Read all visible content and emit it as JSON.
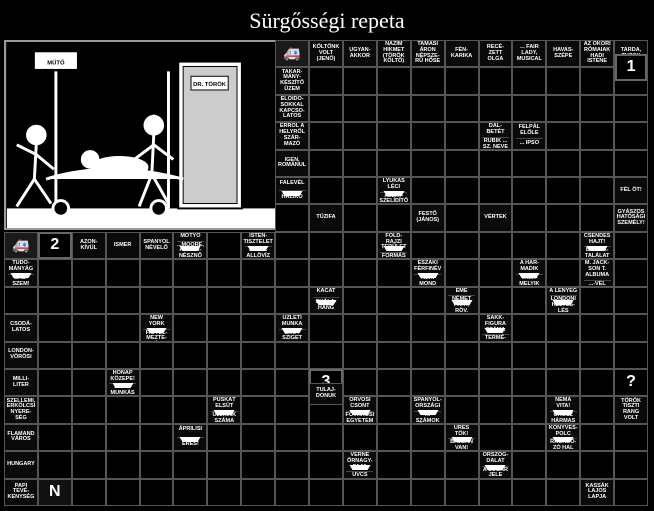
{
  "title": "Sürgősségi repeta",
  "image": {
    "sign_muto": "MŰTŐ",
    "sign_doctor": "DR. TÖRÖK"
  },
  "numbers": {
    "n1": "1",
    "n2": "2",
    "n3": "3",
    "qm": "?",
    "start_letter": "N"
  },
  "clues": {
    "koltonk": "KÖLTŐNK VOLT (JENŐ)",
    "ugyanakkor": "UGYAN-AKKOR",
    "nazim": "NÁZIM HIKMET (TÖRÖK KÖLTŐ)",
    "tamasi": "TAMÁSI ÁRON NÉPSZE-RŰ HŐSE",
    "fenkarika": "FÉN-KARIKA",
    "rece": "RECÉ-ZETT OLGA",
    "fair": "... FAIR LADY, MUSICAL",
    "havasszepe": "HAVAS-SZÉPE",
    "okori": "AZ ÓKORI RÓMAIAK HADI ISTENE",
    "tarda": "TARDA, TUZOK",
    "takarmany": "TAKAR-MÁNY-KÉSZÍTŐ ÜZEM",
    "eloidos": "ELŐIDŐ-SOKKAL KAPCSO-LATOS",
    "errol": "ERRŐL A HELYRŐL SZÁR-MAZÓ",
    "igen": "IGEN, ROMÁNUL",
    "dal": "DAL-BETÉT",
    "rubik": "RUBIK ... SZ. NEVE",
    "felpal": "FELPÁL ELŐLE",
    "ipso": "... IPSO",
    "falevel": "FALEVÉL",
    "haziko": "HÁZIKÓ",
    "lyukasleci": "LYUKAS LÉCI",
    "allat": "ÁLLAT-SZELÍDÍTŐ",
    "tuzifa": "TŰZIFA",
    "festo": "FESTŐ (JÁNOS)",
    "felot": "FÉL ÖT!",
    "gyaszos": "GYÁSZOS HATÓSÁGI SZEMÉLY!",
    "azonkivul": "AZON-KÍVÜL",
    "ismer": "ISMER",
    "spanyol": "SPANYOL NÉVELŐ",
    "motyo": "MOTYÓ",
    "moore": "...MOORE, AM. SZÍ-NÉSZNŐ",
    "isten": "ISTEN-TISZTELET",
    "fnap": "F. NAP. ALLÖVÍZ",
    "fold": "FÖLD-RAJZI TERÜLET",
    "formas": "FORMÁS",
    "vertek": "VÉRTEK",
    "csendes": "CSENDES HAJT!",
    "bomba": "BOMBA-TALÁLAT",
    "tudomany": "TUDO-MÁNYÁG",
    "babszem": "BAB-SZEM!",
    "eszaki": "ÉSZAKI FÉRFINÉV",
    "nerimond": "NÉRI MOND",
    "harmadik": "A HAR-MADIK",
    "valamelyik": "VALA-MELYIK",
    "mjackson": "M. JACK-SON T. ALBUMA",
    "vel": "...-VEL",
    "kacat": "KACAT",
    "skala": "SKÁLA-HANG",
    "eme": "EME",
    "nemet": "NÉMET PÁRT, RÖV.",
    "lenyeg": "A LÉNYEG",
    "london": "LONDONI HELYES-LÉS",
    "csodalatos": "CSODÁ-LATOS",
    "newyork": "NEW YORK",
    "figyel": "FIGYEL-MEZTE-TÉS",
    "uzleti": "ÜZLETI MUNKA",
    "skot": "SKÓT SZIGET",
    "sakk": "SAKK-FIGURA SZÁMA",
    "termeszetes": "TERMÉ-SZETES",
    "londonvorosi": "LONDON-VÖRÖSI",
    "milliliter": "MILLI-LITER",
    "honap": "HÓNAP KÖZEPE!",
    "szakmunkas": "SZAK-MUNKÁS",
    "tulajdonuk": "TULAJ-DONUK",
    "torok": "TÖRÖK TISZTI RANG VOLT",
    "szellemi": "SZELLEMI, ERKÖLCSI NYERE-SÉG",
    "puskat": "PUSKÁT ELSÜT",
    "ujjaink": "UJJAINK SZÁMA",
    "orvosi": "ORVOSI CSONT",
    "fovarosi": "FŐVÁROSI EGYETEM",
    "spanyolorszag": "SPANYOL-ORSZÁGI",
    "rszamok": "R. SZÁMOK ÖSSZ.: 1000",
    "nema": "NÉMA VITA!",
    "orosz": "OROSZ HÁRMAS",
    "flamand": "FLAMAND VÁROS",
    "hungary": "HUNGARY",
    "aprilisi": "ÁPRILISI",
    "eresi": "ERES!",
    "urestok": "ÜRES TÖK!",
    "bajban": "BAJBAN VAN!",
    "konyves": "KÖNYVES-POLC",
    "ragadozo": "RAGADO-ZÓ HAL",
    "verne": "VERNE ŐRNAGY-FAJA",
    "uvcs": "UVCS",
    "orszog": "ÖRSZÖG-DALAT",
    "sugar": "A SUGÁR JELE",
    "papi": "PAPI TEVÉ-KENYSÉG",
    "kassak": "KASSÁK LAJOS LAPJA"
  }
}
